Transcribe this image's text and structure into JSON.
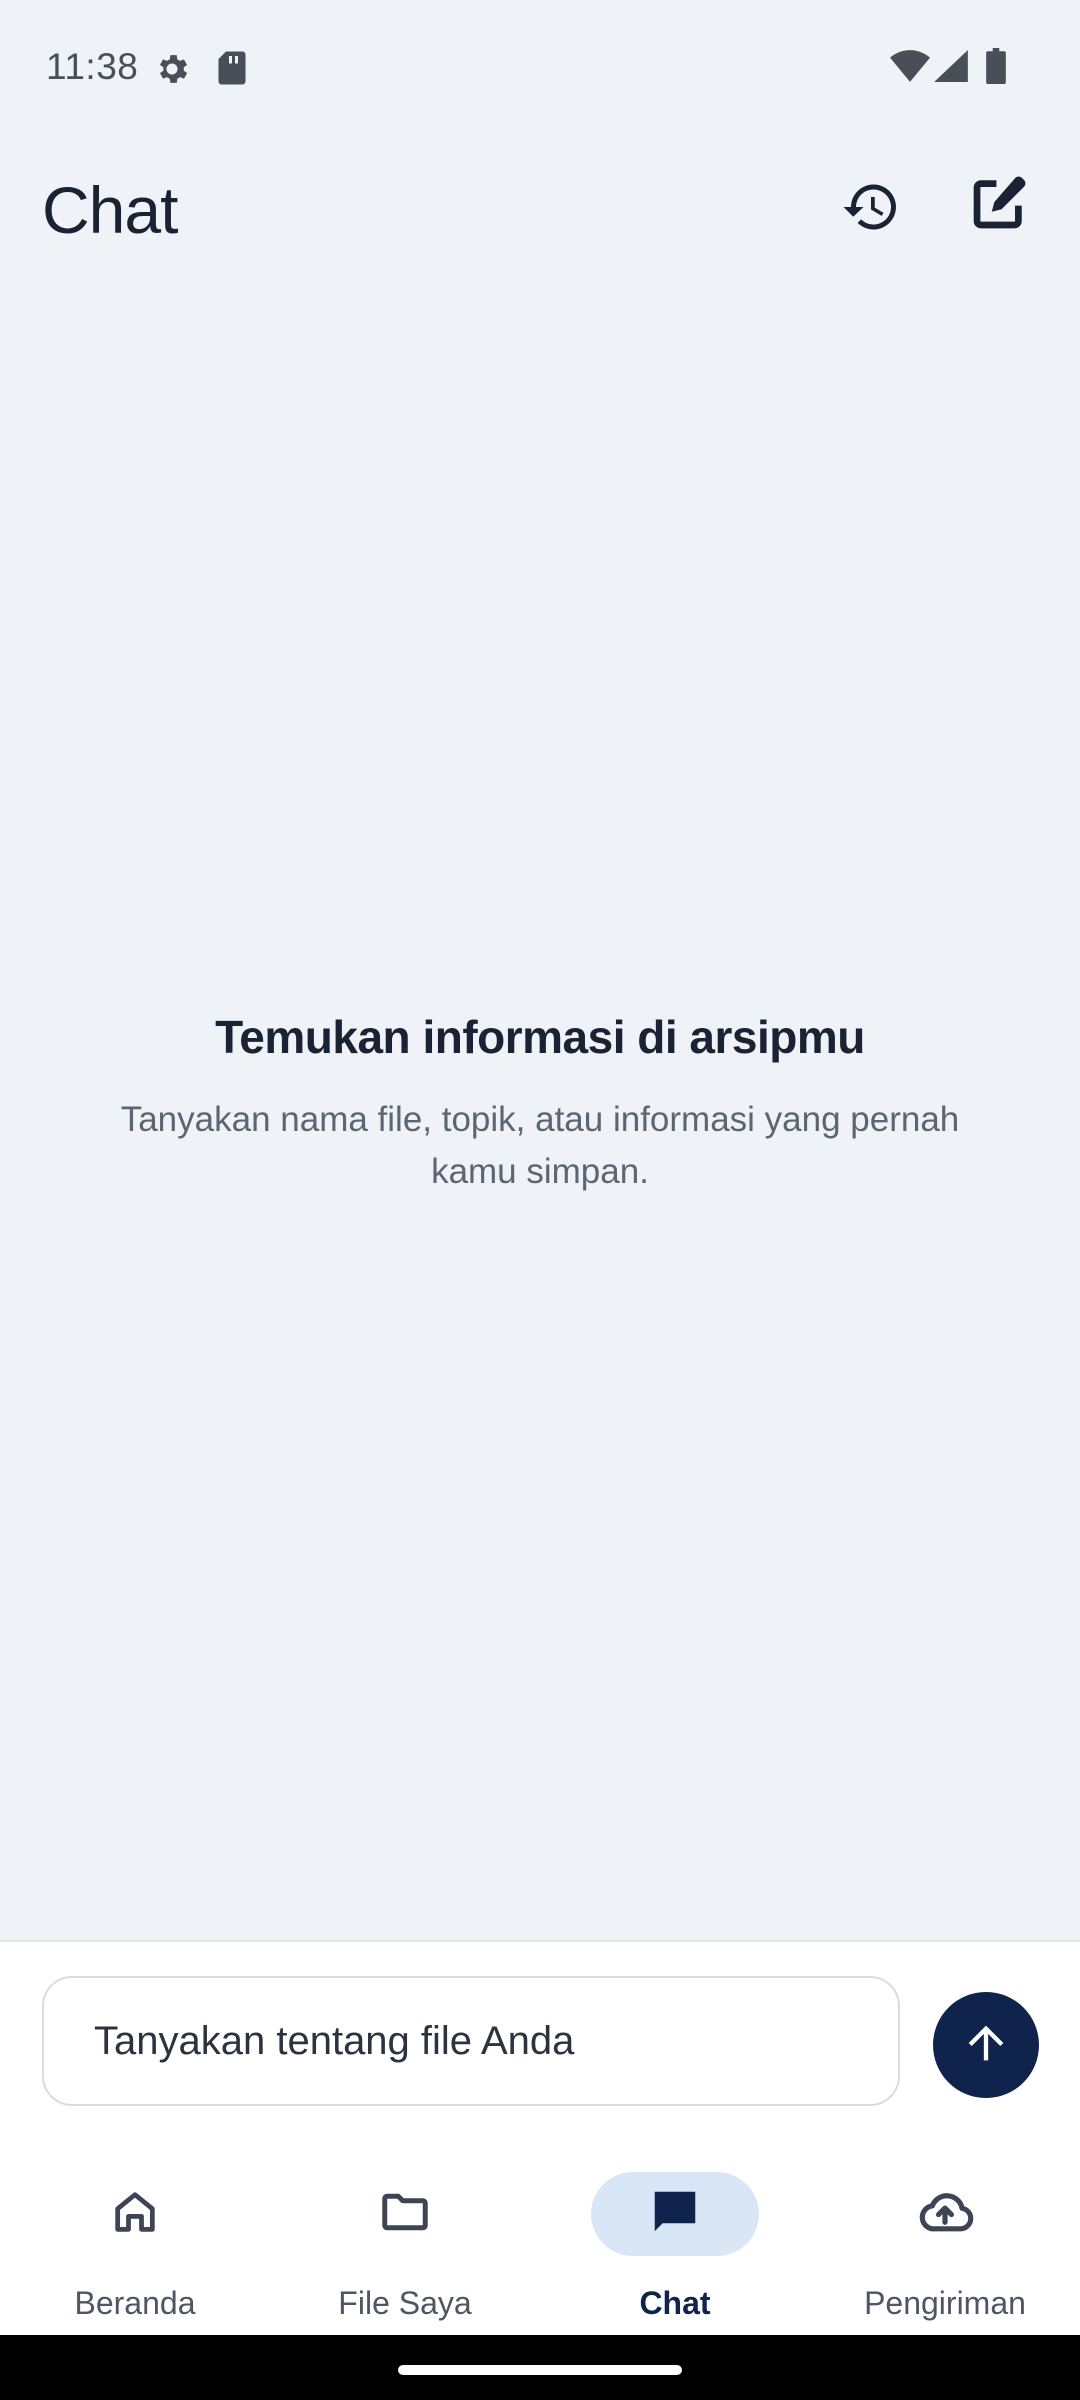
{
  "status_bar": {
    "time": "11:38",
    "icons": [
      "settings-icon",
      "sd-card-icon",
      "wifi-icon",
      "signal-icon",
      "battery-icon"
    ]
  },
  "header": {
    "title": "Chat",
    "actions": [
      "history-icon",
      "new-chat-icon"
    ]
  },
  "empty_state": {
    "title": "Temukan informasi di arsipmu",
    "subtitle": "Tanyakan nama file, topik, atau informasi yang pernah kamu simpan."
  },
  "composer": {
    "placeholder": "Tanyakan tentang file Anda",
    "send_icon": "arrow-up-icon"
  },
  "bottom_nav": {
    "items": [
      {
        "label": "Beranda",
        "icon": "home-icon",
        "active": false
      },
      {
        "label": "File Saya",
        "icon": "folder-icon",
        "active": false
      },
      {
        "label": "Chat",
        "icon": "chat-icon",
        "active": true
      },
      {
        "label": "Pengiriman",
        "icon": "cloud-upload-icon",
        "active": false
      }
    ]
  },
  "colors": {
    "background": "#eff3f7",
    "primary": "#10234c",
    "active_pill": "#d9e6f5",
    "text": "#1b2233",
    "muted_text": "#5d6573"
  }
}
